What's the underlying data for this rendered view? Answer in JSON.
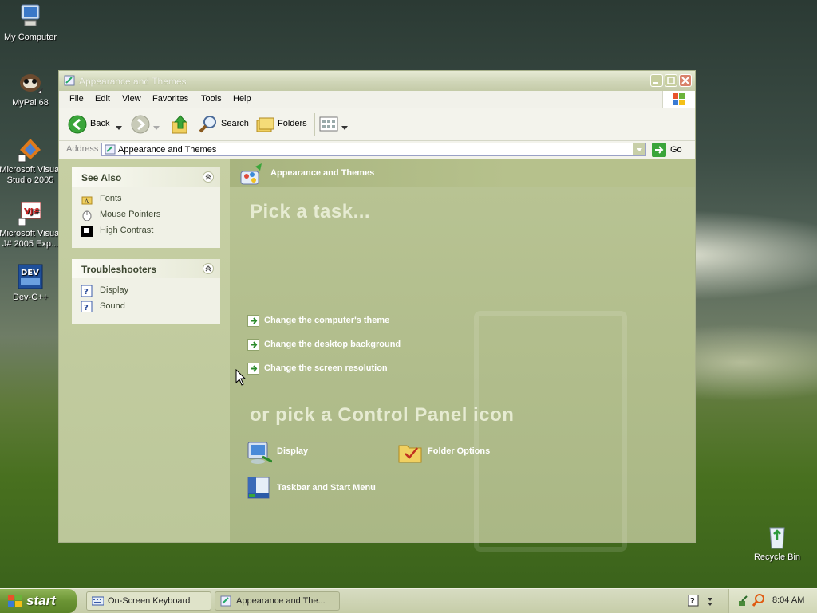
{
  "desktop": {
    "icons": [
      {
        "label": "My Computer"
      },
      {
        "label": "MyPal 68"
      },
      {
        "label": "Microsoft Visual Studio 2005"
      },
      {
        "label": "Microsoft Visual J# 2005 Exp..."
      },
      {
        "label": "Dev-C++"
      },
      {
        "label": "Recycle Bin"
      }
    ]
  },
  "window": {
    "title": "Appearance and Themes",
    "menu": [
      "File",
      "Edit",
      "View",
      "Favorites",
      "Tools",
      "Help"
    ],
    "toolbar": {
      "back": "Back",
      "search": "Search",
      "folders": "Folders"
    },
    "address": {
      "label": "Address",
      "value": "Appearance and Themes",
      "go": "Go"
    },
    "see_also": {
      "title": "See Also",
      "items": [
        "Fonts",
        "Mouse Pointers",
        "High Contrast"
      ]
    },
    "troubleshooters": {
      "title": "Troubleshooters",
      "items": [
        "Display",
        "Sound"
      ]
    },
    "category_title": "Appearance and Themes",
    "pick_task_heading": "Pick a task...",
    "tasks": [
      "Change the computer's theme",
      "Change the desktop background",
      "Change the screen resolution"
    ],
    "pick_icon_heading": "or pick a Control Panel icon",
    "cp_icons": [
      "Display",
      "Folder Options",
      "Taskbar and Start Menu"
    ]
  },
  "taskbar": {
    "start": "start",
    "buttons": [
      "On-Screen Keyboard",
      "Appearance and The..."
    ],
    "clock": "8:04 AM"
  }
}
